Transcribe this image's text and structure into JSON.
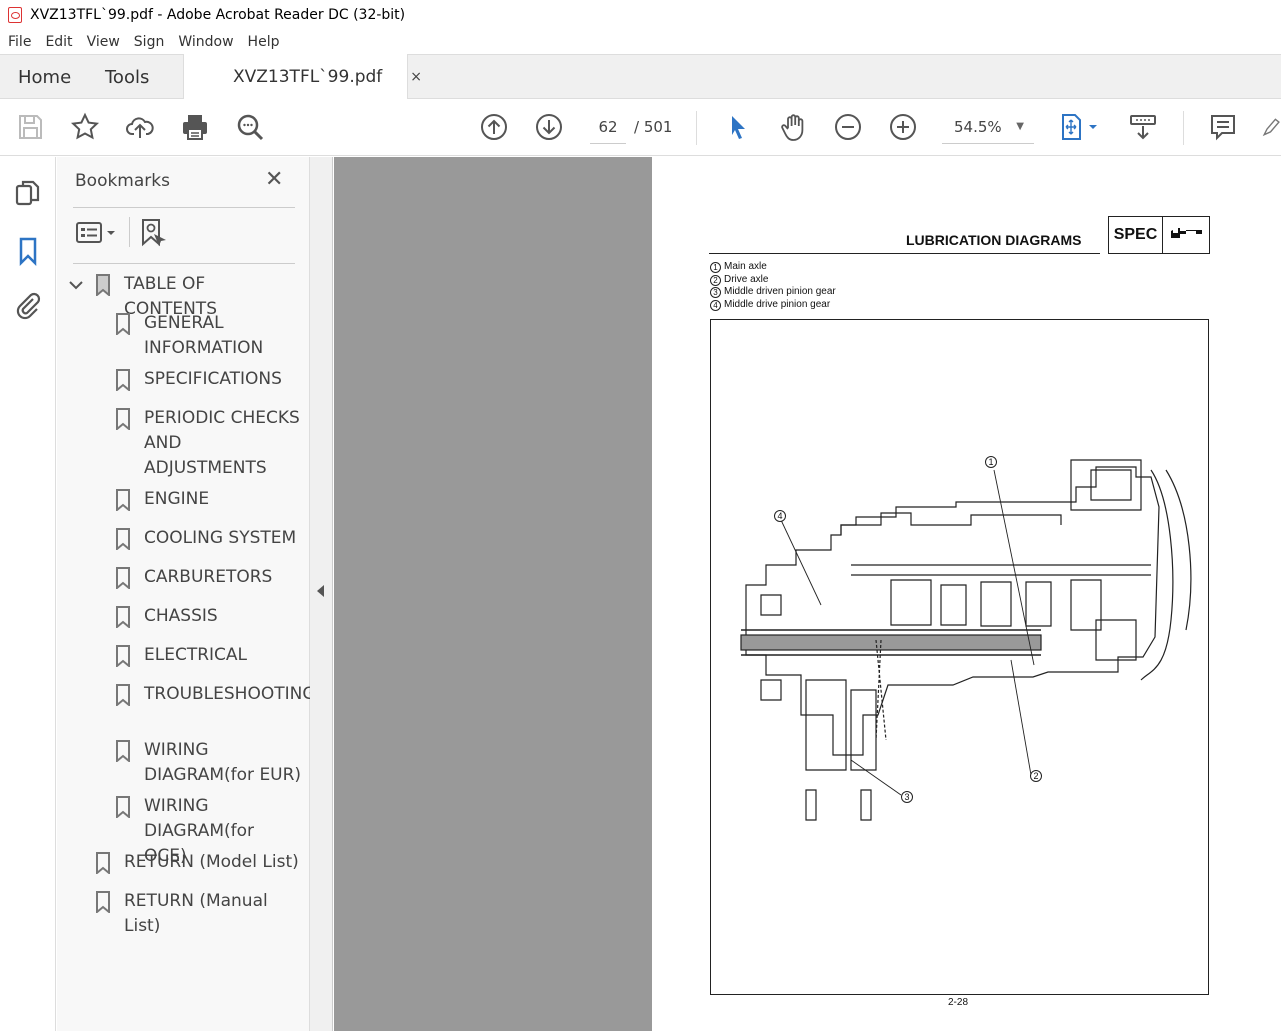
{
  "window": {
    "title": "XVZ13TFL`99.pdf - Adobe Acrobat Reader DC (32-bit)"
  },
  "menu": [
    "File",
    "Edit",
    "View",
    "Sign",
    "Window",
    "Help"
  ],
  "tabs": {
    "home": "Home",
    "tools": "Tools",
    "document": "XVZ13TFL`99.pdf",
    "close": "×"
  },
  "toolbar": {
    "page_current": "62",
    "page_total": "/ 501",
    "zoom": "54.5%",
    "accent": "#2d74c4"
  },
  "bookmarks": {
    "title": "Bookmarks",
    "close": "✕",
    "items": [
      {
        "label": "TABLE OF CONTENTS",
        "level": 0,
        "expanded": true
      },
      {
        "label": "GENERAL INFORMATION",
        "level": 1
      },
      {
        "label": "SPECIFICATIONS",
        "level": 1
      },
      {
        "label": "PERIODIC CHECKS AND ADJUSTMENTS",
        "level": 1
      },
      {
        "label": "ENGINE",
        "level": 1
      },
      {
        "label": "COOLING SYSTEM",
        "level": 1
      },
      {
        "label": "CARBURETORS",
        "level": 1
      },
      {
        "label": "CHASSIS",
        "level": 1
      },
      {
        "label": "ELECTRICAL",
        "level": 1
      },
      {
        "label": "TROUBLESHOOTING",
        "level": 1
      },
      {
        "label": "WIRING DIAGRAM(for EUR)",
        "level": 1
      },
      {
        "label": "WIRING DIAGRAM(for OCE)",
        "level": 1
      },
      {
        "label": "RETURN (Model List)",
        "level": 0
      },
      {
        "label": "RETURN (Manual List)",
        "level": 0
      }
    ]
  },
  "page": {
    "heading": "LUBRICATION DIAGRAMS",
    "spec_label": "SPEC",
    "legend": [
      {
        "num": "1",
        "text": "Main axle"
      },
      {
        "num": "2",
        "text": "Drive axle"
      },
      {
        "num": "3",
        "text": "Middle driven pinion gear"
      },
      {
        "num": "4",
        "text": "Middle drive pinion gear"
      }
    ],
    "callouts": [
      "1",
      "2",
      "3",
      "4"
    ],
    "page_number": "2-28"
  }
}
